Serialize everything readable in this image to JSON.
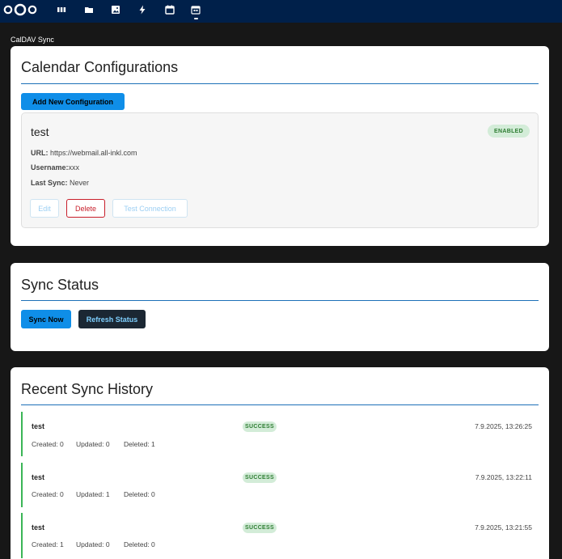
{
  "topbar": {
    "apps": [
      "dashboard-icon",
      "files-icon",
      "photos-icon",
      "activity-icon",
      "calendar-icon",
      "caldav-sync-icon"
    ]
  },
  "app_title": "CalDAV Sync",
  "configurations": {
    "title": "Calendar Configurations",
    "add_button": "Add New Configuration",
    "items": [
      {
        "name": "test",
        "status": "ENABLED",
        "url_label": "URL:",
        "url": "https://webmail.all-inkl.com",
        "username_label": "Username:",
        "username": "xxx",
        "last_sync_label": "Last Sync:",
        "last_sync": "Never",
        "edit_label": "Edit",
        "delete_label": "Delete",
        "test_label": "Test Connection"
      }
    ]
  },
  "sync_status": {
    "title": "Sync Status",
    "sync_now": "Sync Now",
    "refresh": "Refresh Status"
  },
  "history": {
    "title": "Recent Sync History",
    "items": [
      {
        "name": "test",
        "status": "SUCCESS",
        "time": "7.9.2025, 13:26:25",
        "created": "Created: 0",
        "updated": "Updated: 0",
        "deleted": "Deleted: 1"
      },
      {
        "name": "test",
        "status": "SUCCESS",
        "time": "7.9.2025, 13:22:11",
        "created": "Created: 0",
        "updated": "Updated: 1",
        "deleted": "Deleted: 0"
      },
      {
        "name": "test",
        "status": "SUCCESS",
        "time": "7.9.2025, 13:21:55",
        "created": "Created: 1",
        "updated": "Updated: 0",
        "deleted": "Deleted: 0"
      }
    ]
  },
  "colors": {
    "topbar": "#00204a",
    "page_bg": "#171717",
    "primary": "#0f8ee8",
    "success": "#3bb556",
    "danger": "#c81e2a"
  }
}
